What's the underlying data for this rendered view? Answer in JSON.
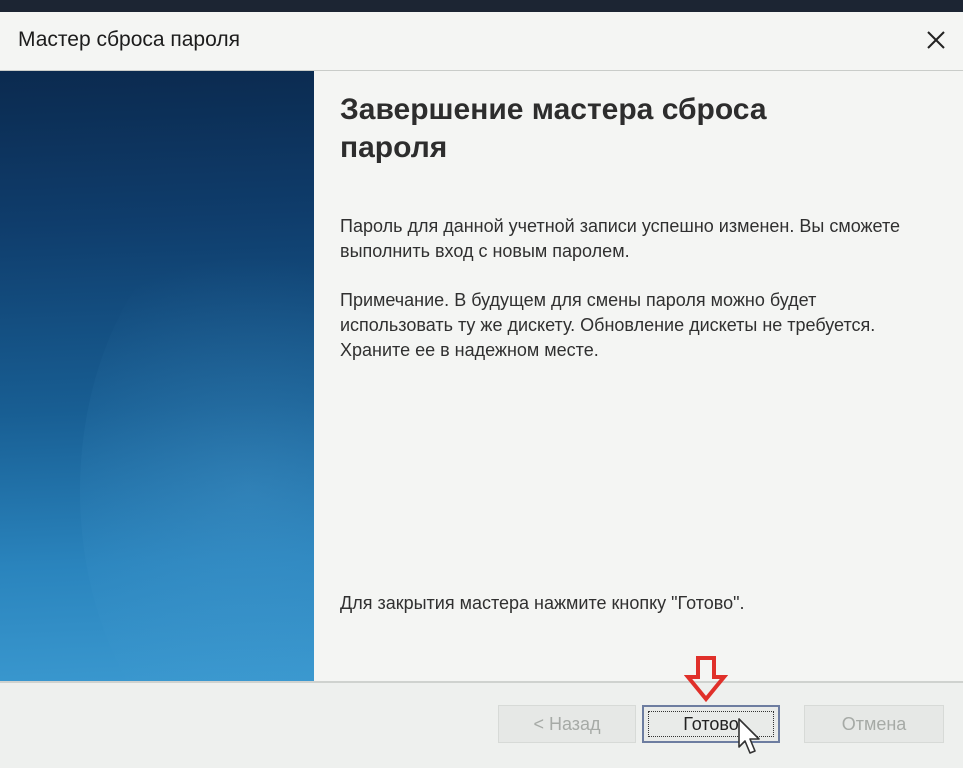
{
  "window": {
    "title": "Мастер сброса пароля",
    "close_icon": "close-icon"
  },
  "content": {
    "heading": "Завершение мастера сброса пароля",
    "paragraph_success": "Пароль для данной учетной записи успешно изменен. Вы сможете выполнить вход с новым паролем.",
    "paragraph_note": "Примечание. В будущем для смены пароля можно будет использовать ту же дискету. Обновление дискеты не требуется. Храните ее в надежном месте.",
    "paragraph_close": "Для закрытия мастера нажмите кнопку \"Готово\"."
  },
  "footer": {
    "back_label": "< Назад",
    "finish_label": "Готово",
    "cancel_label": "Отмена",
    "back_enabled": false,
    "finish_enabled": true,
    "cancel_enabled": false
  },
  "colors": {
    "sidebar_top": "#0b2a4f",
    "sidebar_bottom": "#3a98cf",
    "annotation_arrow": "#e0302a",
    "disabled_text": "#a6aaa6"
  },
  "overlays": {
    "annotation_icon": "red-down-arrow-icon",
    "cursor_icon": "mouse-pointer-icon"
  }
}
